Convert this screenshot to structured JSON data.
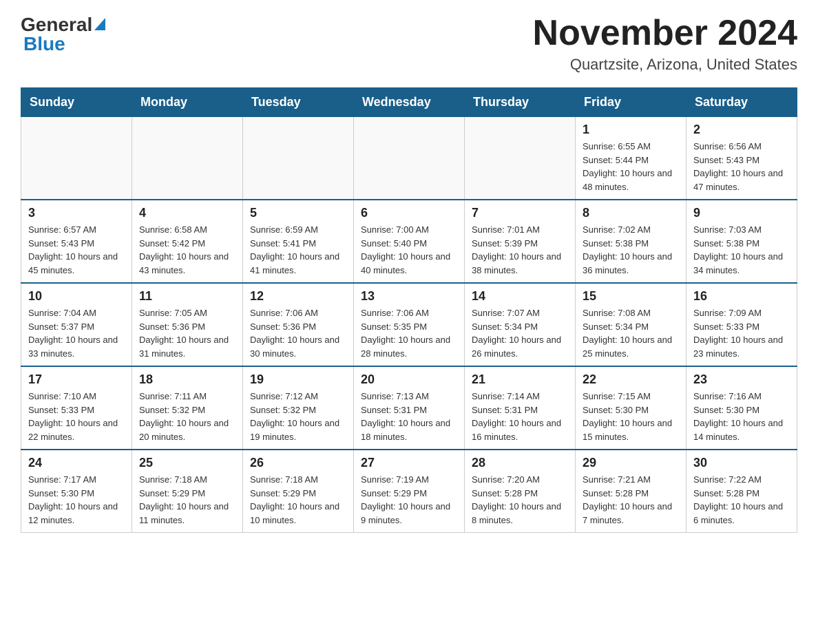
{
  "logo": {
    "text_general": "General",
    "triangle": "▶",
    "text_blue": "Blue"
  },
  "title": "November 2024",
  "subtitle": "Quartzsite, Arizona, United States",
  "weekdays": [
    "Sunday",
    "Monday",
    "Tuesday",
    "Wednesday",
    "Thursday",
    "Friday",
    "Saturday"
  ],
  "weeks": [
    [
      {
        "day": "",
        "info": ""
      },
      {
        "day": "",
        "info": ""
      },
      {
        "day": "",
        "info": ""
      },
      {
        "day": "",
        "info": ""
      },
      {
        "day": "",
        "info": ""
      },
      {
        "day": "1",
        "info": "Sunrise: 6:55 AM\nSunset: 5:44 PM\nDaylight: 10 hours and 48 minutes."
      },
      {
        "day": "2",
        "info": "Sunrise: 6:56 AM\nSunset: 5:43 PM\nDaylight: 10 hours and 47 minutes."
      }
    ],
    [
      {
        "day": "3",
        "info": "Sunrise: 6:57 AM\nSunset: 5:43 PM\nDaylight: 10 hours and 45 minutes."
      },
      {
        "day": "4",
        "info": "Sunrise: 6:58 AM\nSunset: 5:42 PM\nDaylight: 10 hours and 43 minutes."
      },
      {
        "day": "5",
        "info": "Sunrise: 6:59 AM\nSunset: 5:41 PM\nDaylight: 10 hours and 41 minutes."
      },
      {
        "day": "6",
        "info": "Sunrise: 7:00 AM\nSunset: 5:40 PM\nDaylight: 10 hours and 40 minutes."
      },
      {
        "day": "7",
        "info": "Sunrise: 7:01 AM\nSunset: 5:39 PM\nDaylight: 10 hours and 38 minutes."
      },
      {
        "day": "8",
        "info": "Sunrise: 7:02 AM\nSunset: 5:38 PM\nDaylight: 10 hours and 36 minutes."
      },
      {
        "day": "9",
        "info": "Sunrise: 7:03 AM\nSunset: 5:38 PM\nDaylight: 10 hours and 34 minutes."
      }
    ],
    [
      {
        "day": "10",
        "info": "Sunrise: 7:04 AM\nSunset: 5:37 PM\nDaylight: 10 hours and 33 minutes."
      },
      {
        "day": "11",
        "info": "Sunrise: 7:05 AM\nSunset: 5:36 PM\nDaylight: 10 hours and 31 minutes."
      },
      {
        "day": "12",
        "info": "Sunrise: 7:06 AM\nSunset: 5:36 PM\nDaylight: 10 hours and 30 minutes."
      },
      {
        "day": "13",
        "info": "Sunrise: 7:06 AM\nSunset: 5:35 PM\nDaylight: 10 hours and 28 minutes."
      },
      {
        "day": "14",
        "info": "Sunrise: 7:07 AM\nSunset: 5:34 PM\nDaylight: 10 hours and 26 minutes."
      },
      {
        "day": "15",
        "info": "Sunrise: 7:08 AM\nSunset: 5:34 PM\nDaylight: 10 hours and 25 minutes."
      },
      {
        "day": "16",
        "info": "Sunrise: 7:09 AM\nSunset: 5:33 PM\nDaylight: 10 hours and 23 minutes."
      }
    ],
    [
      {
        "day": "17",
        "info": "Sunrise: 7:10 AM\nSunset: 5:33 PM\nDaylight: 10 hours and 22 minutes."
      },
      {
        "day": "18",
        "info": "Sunrise: 7:11 AM\nSunset: 5:32 PM\nDaylight: 10 hours and 20 minutes."
      },
      {
        "day": "19",
        "info": "Sunrise: 7:12 AM\nSunset: 5:32 PM\nDaylight: 10 hours and 19 minutes."
      },
      {
        "day": "20",
        "info": "Sunrise: 7:13 AM\nSunset: 5:31 PM\nDaylight: 10 hours and 18 minutes."
      },
      {
        "day": "21",
        "info": "Sunrise: 7:14 AM\nSunset: 5:31 PM\nDaylight: 10 hours and 16 minutes."
      },
      {
        "day": "22",
        "info": "Sunrise: 7:15 AM\nSunset: 5:30 PM\nDaylight: 10 hours and 15 minutes."
      },
      {
        "day": "23",
        "info": "Sunrise: 7:16 AM\nSunset: 5:30 PM\nDaylight: 10 hours and 14 minutes."
      }
    ],
    [
      {
        "day": "24",
        "info": "Sunrise: 7:17 AM\nSunset: 5:30 PM\nDaylight: 10 hours and 12 minutes."
      },
      {
        "day": "25",
        "info": "Sunrise: 7:18 AM\nSunset: 5:29 PM\nDaylight: 10 hours and 11 minutes."
      },
      {
        "day": "26",
        "info": "Sunrise: 7:18 AM\nSunset: 5:29 PM\nDaylight: 10 hours and 10 minutes."
      },
      {
        "day": "27",
        "info": "Sunrise: 7:19 AM\nSunset: 5:29 PM\nDaylight: 10 hours and 9 minutes."
      },
      {
        "day": "28",
        "info": "Sunrise: 7:20 AM\nSunset: 5:28 PM\nDaylight: 10 hours and 8 minutes."
      },
      {
        "day": "29",
        "info": "Sunrise: 7:21 AM\nSunset: 5:28 PM\nDaylight: 10 hours and 7 minutes."
      },
      {
        "day": "30",
        "info": "Sunrise: 7:22 AM\nSunset: 5:28 PM\nDaylight: 10 hours and 6 minutes."
      }
    ]
  ]
}
